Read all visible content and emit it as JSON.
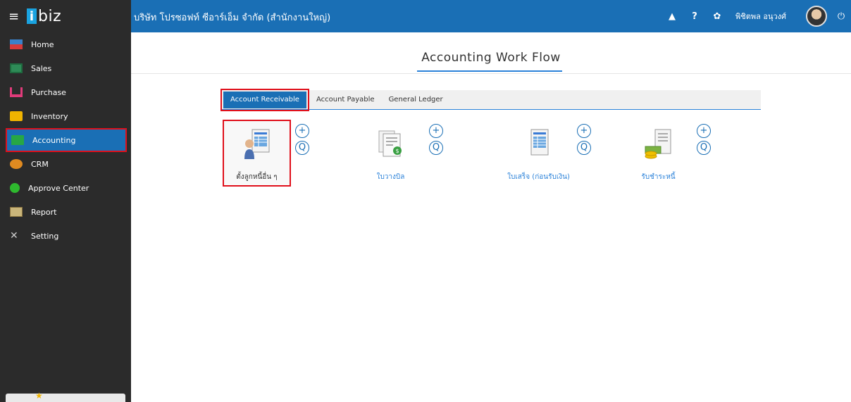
{
  "sidebar": {
    "brand": {
      "menu_icon": "hamburger-icon",
      "logo_i": "i",
      "logo_rest": "biz"
    },
    "items": [
      {
        "label": "Home",
        "icon": "home-icon"
      },
      {
        "label": "Sales",
        "icon": "sales-icon"
      },
      {
        "label": "Purchase",
        "icon": "cart-icon"
      },
      {
        "label": "Inventory",
        "icon": "box-icon"
      },
      {
        "label": "Accounting",
        "icon": "book-icon",
        "active": true
      },
      {
        "label": "CRM",
        "icon": "people-icon"
      },
      {
        "label": "Approve Center",
        "icon": "check-circle-icon"
      },
      {
        "label": "Report",
        "icon": "report-icon"
      },
      {
        "label": "Setting",
        "icon": "tools-icon"
      }
    ]
  },
  "topbar": {
    "company": "บริษัท โปรซอฟท์ ซีอาร์เอ็ม จำกัด (สำนักงานใหญ่)",
    "username": "พิชิตพล อนุวงศ์",
    "icons": [
      "bell-icon",
      "help-icon",
      "gear-icon",
      "avatar",
      "power-icon"
    ],
    "accent": "#1a6fb5"
  },
  "main": {
    "title": "Accounting Work Flow",
    "tabs": [
      {
        "label": "Account Receivable",
        "active": true
      },
      {
        "label": "Account Payable"
      },
      {
        "label": "General Ledger"
      }
    ],
    "cards": [
      {
        "label": "ตั้งลูกหนี้อื่น ๆ",
        "icon": "person-ledger-icon",
        "selected": true,
        "add": "+",
        "search": "Q"
      },
      {
        "label": "ใบวางบิล",
        "icon": "invoice-icon",
        "add": "+",
        "search": "Q"
      },
      {
        "label": "ใบเสร็จ (ก่อนรับเงิน)",
        "icon": "receipt-icon",
        "add": "+",
        "search": "Q"
      },
      {
        "label": "รับชำระหนี้",
        "icon": "payment-icon",
        "add": "+",
        "search": "Q"
      }
    ]
  }
}
